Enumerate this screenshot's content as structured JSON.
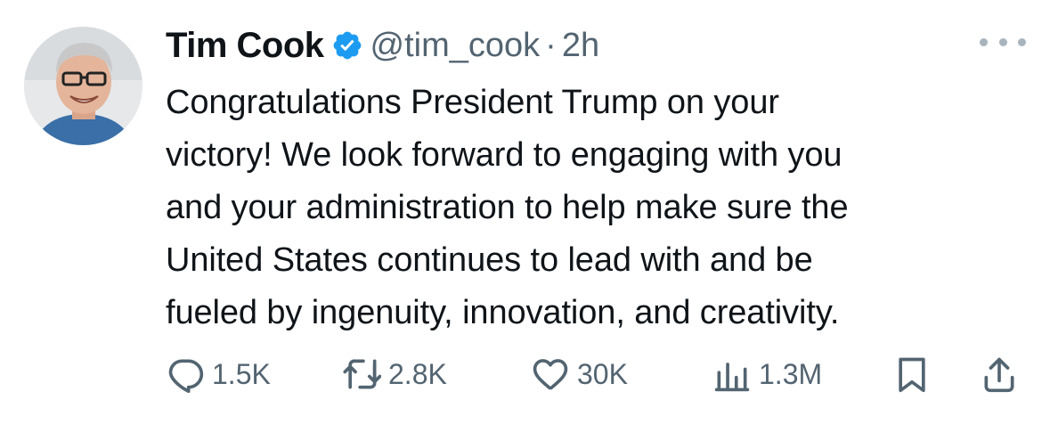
{
  "tweet": {
    "author_name": "Tim Cook",
    "handle": "@tim_cook",
    "separator": "·",
    "time": "2h",
    "text_lines": [
      "Congratulations President Trump on your",
      "victory!  We look forward to engaging with you",
      "and your administration to help make sure the",
      "United States continues to lead with and be",
      "fueled by ingenuity, innovation, and creativity."
    ]
  },
  "metrics": {
    "replies": "1.5K",
    "retweets": "2.8K",
    "likes": "30K",
    "views": "1.3M"
  },
  "icons": {
    "verified": "verified-badge-icon",
    "more": "more-icon",
    "reply": "reply-icon",
    "retweet": "retweet-icon",
    "like": "heart-icon",
    "views": "views-icon",
    "bookmark": "bookmark-icon",
    "share": "share-icon"
  },
  "colors": {
    "verified_blue": "#1d9bf0",
    "text": "#0f1419",
    "secondary": "#536471"
  }
}
